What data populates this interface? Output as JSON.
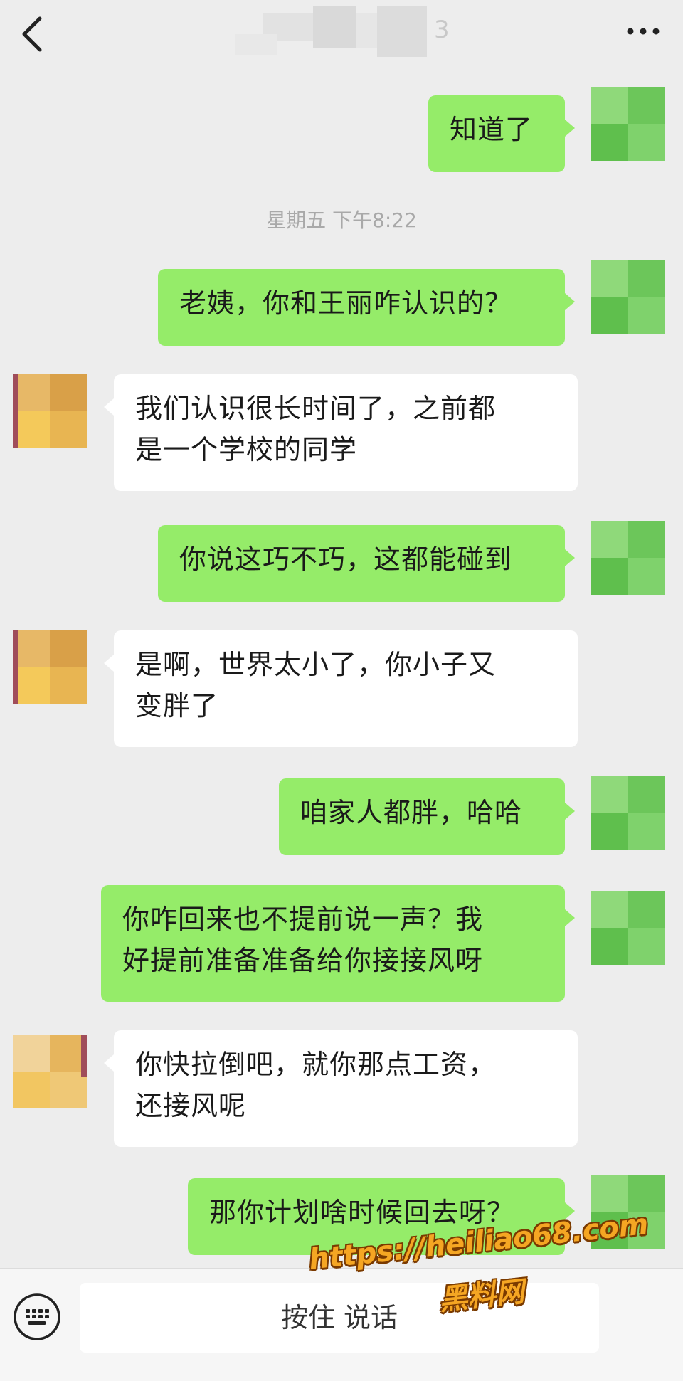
{
  "header": {
    "title": "3",
    "back_icon": "chevron-left-icon",
    "more_icon": "more-dots-icon"
  },
  "chat": {
    "timestamp": "星期五 下午8:22",
    "messages": [
      {
        "side": "me",
        "lines": [
          "知道了"
        ]
      },
      {
        "side": "me",
        "lines": [
          "老姨，你和王丽咋认识的？"
        ]
      },
      {
        "side": "them",
        "lines": [
          "我们认识很长时间了，之前都",
          "是一个学校的同学"
        ]
      },
      {
        "side": "me",
        "lines": [
          "你说这巧不巧，这都能碰到"
        ]
      },
      {
        "side": "them",
        "lines": [
          "是啊，世界太小了，你小子又",
          "变胖了"
        ]
      },
      {
        "side": "me",
        "lines": [
          "咱家人都胖，哈哈"
        ]
      },
      {
        "side": "me",
        "lines": [
          "你咋回来也不提前说一声？我",
          "好提前准备准备给你接接风呀"
        ]
      },
      {
        "side": "them",
        "lines": [
          "你快拉倒吧，就你那点工资，",
          "还接风呢"
        ]
      },
      {
        "side": "me",
        "lines": [
          "那你计划啥时候回去呀？"
        ]
      }
    ]
  },
  "input_bar": {
    "keyboard_icon": "keyboard-icon",
    "hold_to_talk_label": "按住 说话"
  },
  "watermark": {
    "url": "https://heiliao68.com",
    "name": "黑料网"
  },
  "colors": {
    "background": "#ededed",
    "my_bubble": "#95ec69",
    "their_bubble": "#ffffff",
    "watermark": "#f5a623"
  }
}
